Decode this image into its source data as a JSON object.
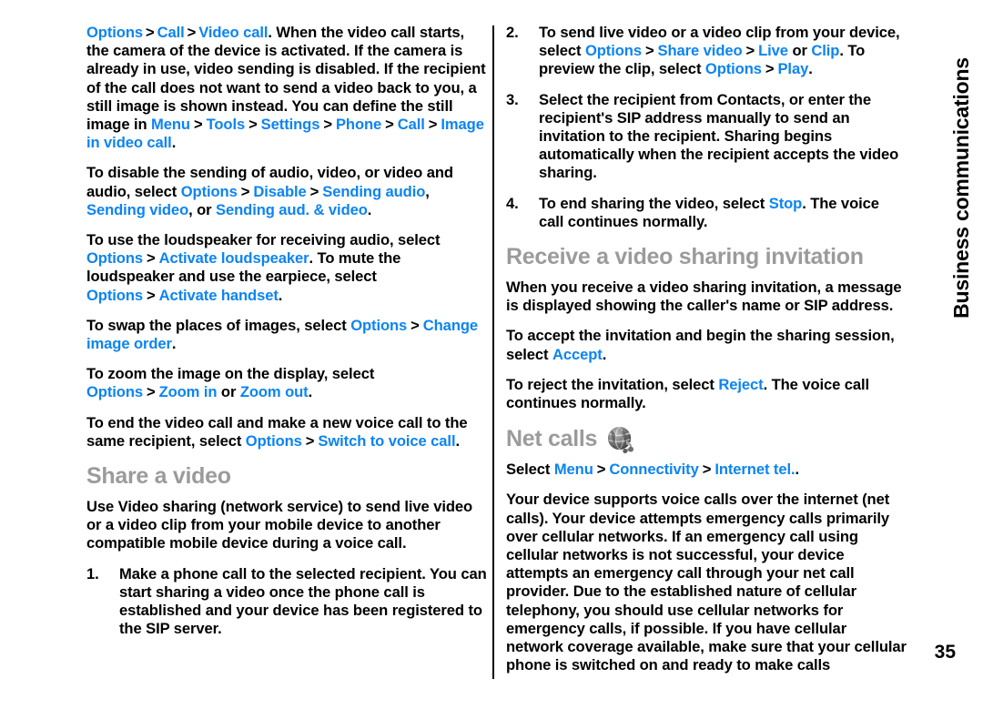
{
  "page": {
    "number": "35",
    "side_tab_label": "Business communications",
    "link_color": "#0b84f3",
    "heading_color": "#9b9b9b",
    "body_color": "#000000"
  },
  "left_column": {
    "para_video_call": {
      "l1": "Options",
      "l2": "Call",
      "l3": "Video call",
      "t1": ". When the video call starts, the camera of the device is activated. If the camera is already in use, video sending is disabled. If the recipient of the call does not want to send a video back to you, a still image is shown instead. You can define the still image in ",
      "l4": "Menu",
      "l5": "Tools",
      "l6": "Settings",
      "l7": "Phone",
      "l8": "Call",
      "l9": "Image in video call",
      "t2": "."
    },
    "para_disable": {
      "t1": "To disable the sending of audio, video, or video and audio, select ",
      "l1": "Options",
      "l2": "Disable",
      "l3": "Sending audio",
      "t2": ", ",
      "l4": "Sending video",
      "t3": ", or ",
      "l5": "Sending aud. & video",
      "t4": "."
    },
    "para_loudspeaker": {
      "t1": "To use the loudspeaker for receiving audio, select ",
      "l1": "Options",
      "l2": "Activate loudspeaker",
      "t2": ". To mute the loudspeaker and use the earpiece, select ",
      "l3": "Options",
      "l4": "Activate handset",
      "t3": "."
    },
    "para_swap": {
      "t1": "To swap the places of images, select ",
      "l1": "Options",
      "l2": "Change image order",
      "t2": "."
    },
    "para_zoom": {
      "t1": "To zoom the image on the display, select ",
      "l1": "Options",
      "l2": "Zoom in",
      "t2": " or ",
      "l3": "Zoom out",
      "t3": "."
    },
    "para_endcall": {
      "t1": "To end the video call and make a new voice call to the same recipient, select ",
      "l1": "Options",
      "l2": "Switch to voice call",
      "t2": "."
    },
    "heading_share_video": "Share a video",
    "para_share_intro": "Use Video sharing (network service) to send live video or a video clip from your mobile device to another compatible mobile device during a voice call.",
    "step1": {
      "num": "1.",
      "text": "Make a phone call to the selected recipient. You can start sharing a video once the phone call is established and your device has been registered to the SIP server."
    }
  },
  "right_column": {
    "step2": {
      "num": "2.",
      "t1": "To send live video or a video clip from your device, select ",
      "l1": "Options",
      "l2": "Share video",
      "l3": "Live",
      "t2": " or ",
      "l4": "Clip",
      "t3": ". To preview the clip, select ",
      "l5": "Options",
      "l6": "Play",
      "t4": "."
    },
    "step3": {
      "num": "3.",
      "text": "Select the recipient from Contacts, or enter the recipient's SIP address manually to send an invitation to the recipient. Sharing begins automatically when the recipient accepts the video sharing."
    },
    "step4": {
      "num": "4.",
      "t1": "To end sharing the video, select ",
      "l1": "Stop",
      "t2": ". The voice call continues normally."
    },
    "heading_receive": "Receive a video sharing invitation",
    "para_receive_intro": "When you receive a video sharing invitation, a message is displayed showing the caller's name or SIP address.",
    "para_accept": {
      "t1": "To accept the invitation and begin the sharing session, select ",
      "l1": "Accept",
      "t2": "."
    },
    "para_reject": {
      "t1": "To reject the invitation, select ",
      "l1": "Reject",
      "t2": ". The voice call continues normally."
    },
    "heading_net_calls": "Net calls",
    "net_calls_icon": "globe-headset-icon",
    "para_select_path": {
      "t1": "Select ",
      "l1": "Menu",
      "l2": "Connectivity",
      "l3": "Internet tel.",
      "t2": "."
    },
    "para_net_calls_body": "Your device supports voice calls over the internet (net calls). Your device attempts emergency calls primarily over cellular networks. If an emergency call using cellular networks is not successful, your device attempts an emergency call through your net call provider. Due to the established nature of cellular telephony, you should use cellular networks for emergency calls, if possible. If you have cellular network coverage available, make sure that your cellular phone is switched on and ready to make calls"
  },
  "symbols": {
    "gt": ">"
  }
}
